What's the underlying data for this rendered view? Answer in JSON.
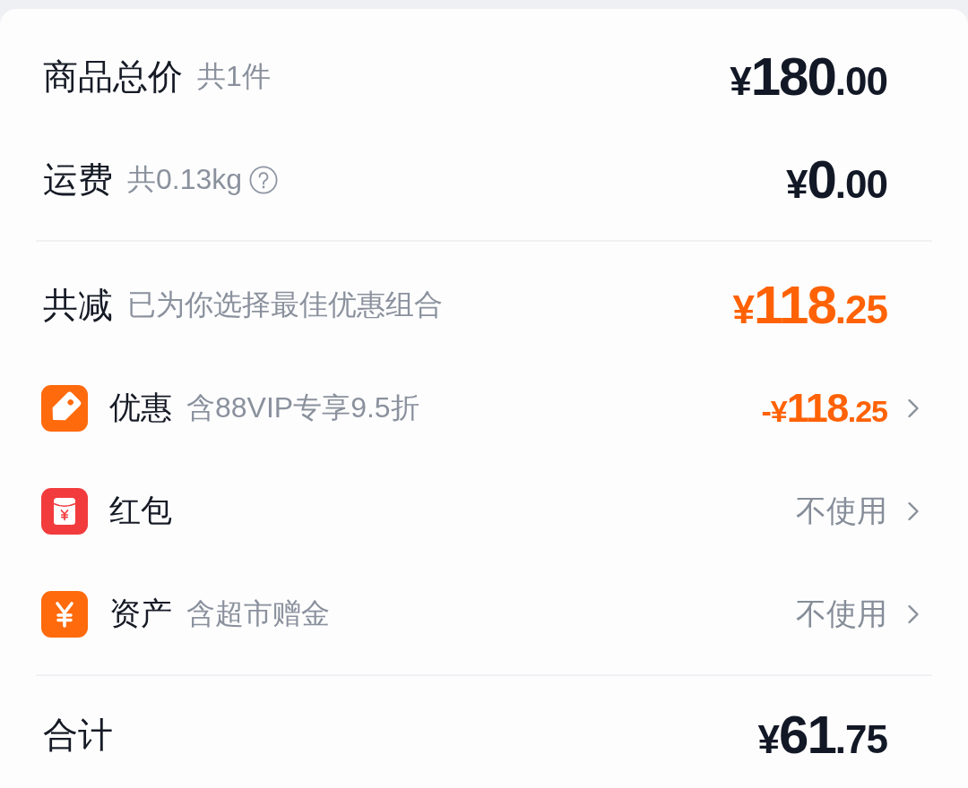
{
  "summary": [
    {
      "label": "商品总价",
      "note": "共1件",
      "help": false,
      "amount": {
        "currency": "¥",
        "whole": "180",
        "fraction": ".00",
        "accent": false
      }
    },
    {
      "label": "运费",
      "note": "共0.13kg",
      "help": true,
      "amount": {
        "currency": "¥",
        "whole": "0",
        "fraction": ".00",
        "accent": false
      }
    }
  ],
  "savings": {
    "label": "共减",
    "note": "已为你选择最佳优惠组合",
    "amount": {
      "currency": "¥",
      "whole": "118",
      "fraction": ".25",
      "accent": true
    }
  },
  "benefits": [
    {
      "kind": "coupon",
      "label": "优惠",
      "note": "含88VIP专享9.5折",
      "amount": {
        "currency": "-¥",
        "whole": "118",
        "fraction": ".25",
        "accent": true
      }
    },
    {
      "kind": "red_packet",
      "label": "红包",
      "value": "不使用"
    },
    {
      "kind": "assets",
      "label": "资产",
      "note": "含超市赠金",
      "value": "不使用"
    }
  ],
  "total": {
    "label": "合计",
    "amount": {
      "currency": "¥",
      "whole": "61",
      "fraction": ".75",
      "accent": false
    }
  }
}
